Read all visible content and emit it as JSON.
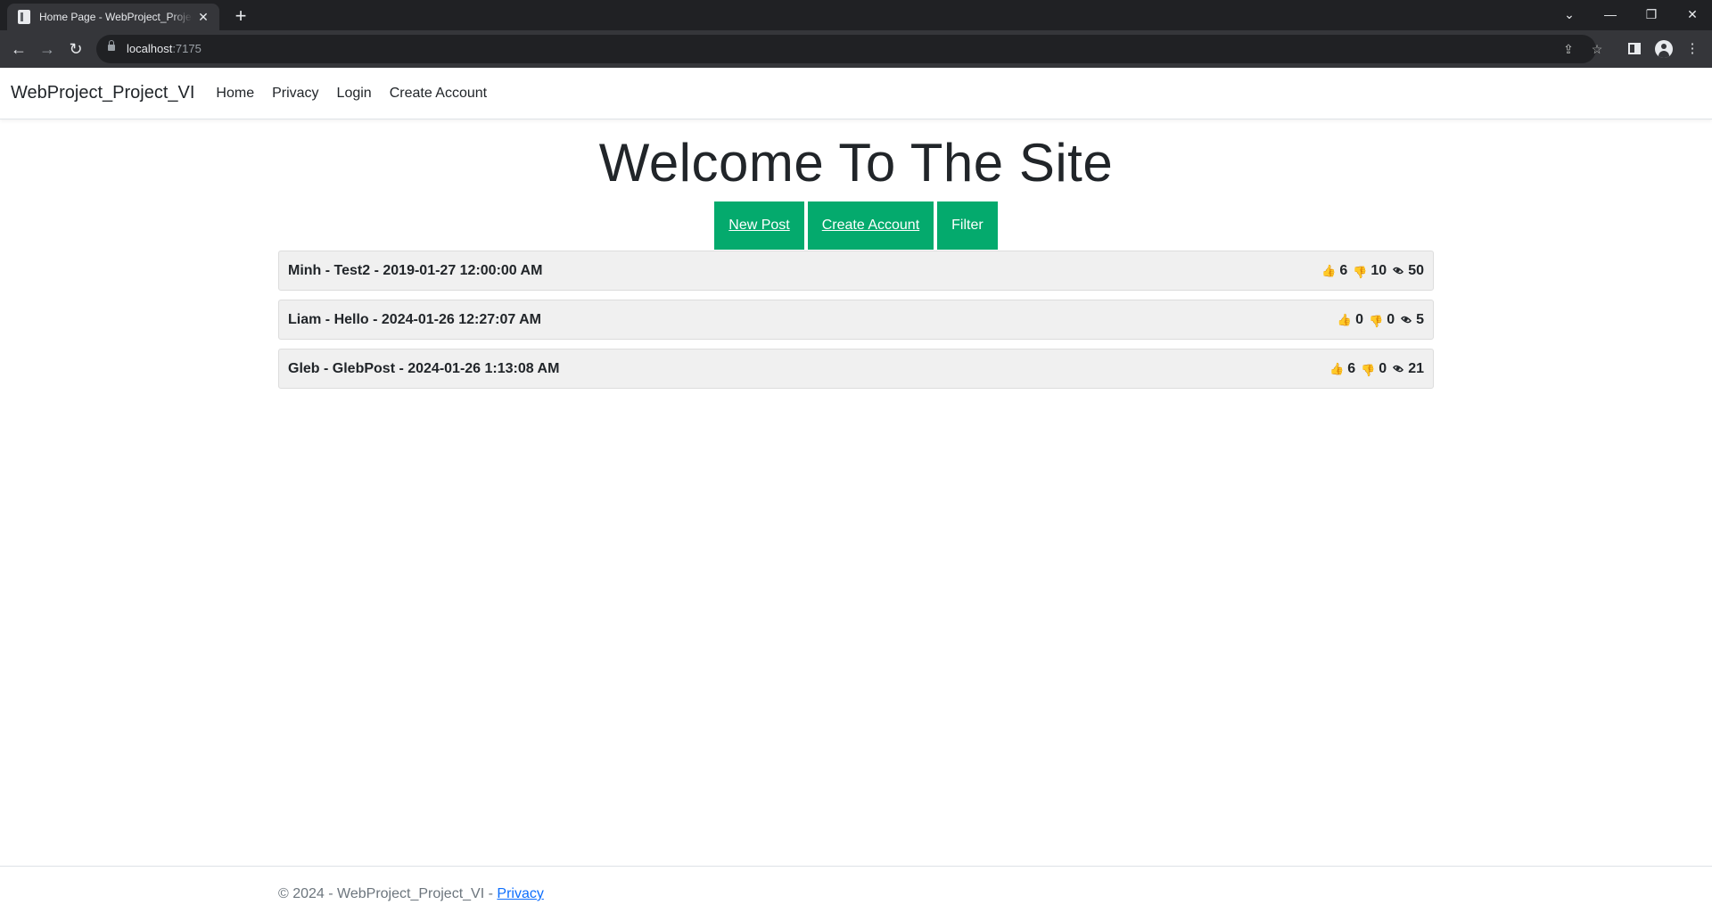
{
  "browser": {
    "tab_title": "Home Page - WebProject_Project_VI",
    "close_glyph": "✕",
    "new_tab_glyph": "+",
    "url_host": "localhost",
    "url_port": ":7175",
    "window_controls": {
      "dropdown": "⌄",
      "minimize": "—",
      "restore": "❐",
      "close": "✕"
    },
    "nav": {
      "back": "←",
      "forward": "→",
      "reload": "↻"
    },
    "omni_icons": {
      "share": "⇪",
      "bookmark": "☆"
    },
    "menu_glyph": "⋮"
  },
  "navbar": {
    "brand": "WebProject_Project_VI",
    "links": [
      "Home",
      "Privacy",
      "Login",
      "Create Account"
    ]
  },
  "main": {
    "heading": "Welcome To The Site",
    "buttons": [
      "New Post",
      "Create Account",
      "Filter"
    ],
    "accent_color": "#04aa6d",
    "posts": [
      {
        "title": "Minh - Test2 - 2019-01-27 12:00:00 AM",
        "likes": "6",
        "dislikes": "10",
        "views": "50"
      },
      {
        "title": "Liam - Hello - 2024-01-26 12:27:07 AM",
        "likes": "0",
        "dislikes": "0",
        "views": "5"
      },
      {
        "title": "Gleb - GlebPost - 2024-01-26 1:13:08 AM",
        "likes": "6",
        "dislikes": "0",
        "views": "21"
      }
    ],
    "icons": {
      "like": "thumbs-up-icon",
      "dislike": "thumbs-down-icon",
      "views": "eye-icon"
    }
  },
  "footer": {
    "text": "© 2024 - WebProject_Project_VI - ",
    "link": "Privacy"
  }
}
